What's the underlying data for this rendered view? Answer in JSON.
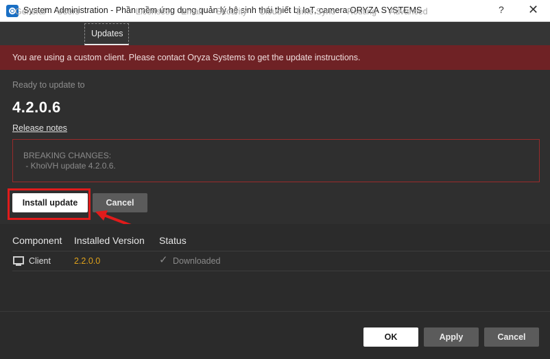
{
  "window": {
    "title": "System Administration - Phần mềm ứng dụng quản lý hệ sinh thái thiết bị IoT, camera ORYZA SYSTEMS",
    "help_glyph": "?",
    "close_glyph": "✕"
  },
  "tabs": [
    {
      "label": "General",
      "active": false
    },
    {
      "label": "Users",
      "active": false
    },
    {
      "label": "Updates",
      "active": true
    },
    {
      "label": "Licenses",
      "active": false
    },
    {
      "label": "Email",
      "active": false
    },
    {
      "label": "Security",
      "active": false
    },
    {
      "label": "Cloud",
      "active": false
    },
    {
      "label": "Time Sync",
      "active": false
    },
    {
      "label": "Routing",
      "active": false
    },
    {
      "label": "Advanced",
      "active": false
    }
  ],
  "banner": {
    "text": "You are using a custom client. Please contact Oryza Systems to get the update instructions."
  },
  "update": {
    "ready_label": "Ready to update to",
    "version": "4.2.0.6",
    "release_notes_link": "Release notes",
    "notes_lines": [
      "BREAKING CHANGES:",
      " - KhoiVH update 4.2.0.6."
    ],
    "install_label": "Install update",
    "cancel_label": "Cancel"
  },
  "components_table": {
    "columns": [
      "Component",
      "Installed Version",
      "Status"
    ],
    "rows": [
      {
        "component": "Client",
        "version": "2.2.0.0",
        "status": "Downloaded"
      }
    ]
  },
  "footer": {
    "ok_label": "OK",
    "apply_label": "Apply",
    "cancel_label": "Cancel"
  },
  "colors": {
    "banner_bg": "#6f2225",
    "version_text": "#e0a21a",
    "highlight": "#e11b1b"
  }
}
